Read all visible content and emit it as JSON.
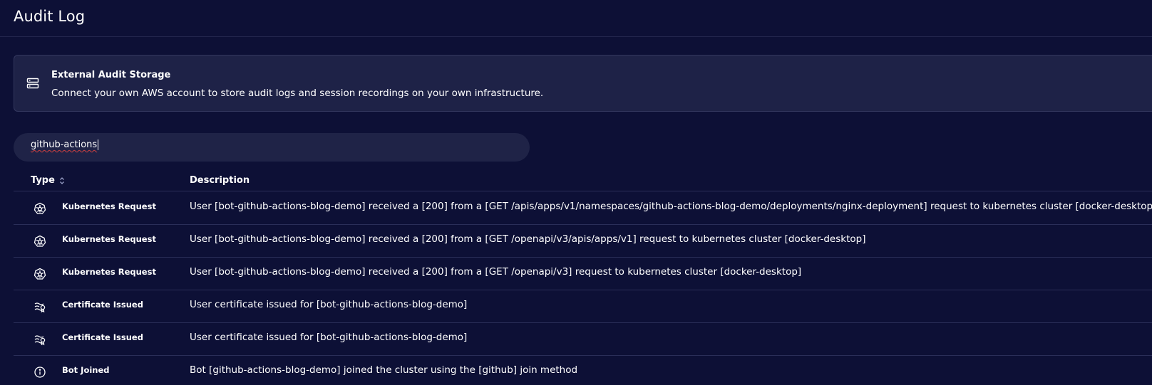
{
  "header": {
    "title": "Audit Log"
  },
  "storage_card": {
    "title": "External Audit Storage",
    "description": "Connect your own AWS account to store audit logs and session recordings on your own infrastructure.",
    "icon": "server-icon"
  },
  "search": {
    "value": "github-actions"
  },
  "table": {
    "columns": {
      "type": "Type",
      "description": "Description"
    },
    "rows": [
      {
        "icon": "kubernetes-icon",
        "type": "Kubernetes Request",
        "description": "User [bot-github-actions-blog-demo] received a [200] from a [GET /apis/apps/v1/namespaces/github-actions-blog-demo/deployments/nginx-deployment] request to kubernetes cluster [docker-desktop]"
      },
      {
        "icon": "kubernetes-icon",
        "type": "Kubernetes Request",
        "description": "User [bot-github-actions-blog-demo] received a [200] from a [GET /openapi/v3/apis/apps/v1] request to kubernetes cluster [docker-desktop]"
      },
      {
        "icon": "kubernetes-icon",
        "type": "Kubernetes Request",
        "description": "User [bot-github-actions-blog-demo] received a [200] from a [GET /openapi/v3] request to kubernetes cluster [docker-desktop]"
      },
      {
        "icon": "certificate-icon",
        "type": "Certificate Issued",
        "description": "User certificate issued for [bot-github-actions-blog-demo]"
      },
      {
        "icon": "certificate-icon",
        "type": "Certificate Issued",
        "description": "User certificate issued for [bot-github-actions-blog-demo]"
      },
      {
        "icon": "info-icon",
        "type": "Bot Joined",
        "description": "Bot [github-actions-blog-demo] joined the cluster using the [github] join method"
      }
    ]
  },
  "colors": {
    "background": "#0d1036",
    "card": "#1e2247",
    "search": "#1f2347",
    "divider": "#2a2e58"
  }
}
